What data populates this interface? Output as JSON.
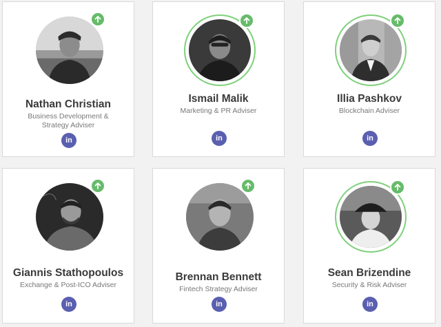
{
  "advisers": [
    {
      "name": "Nathan Christian",
      "role": "Business Development & Strategy Adviser",
      "linkedin_label": "in",
      "badge_icon": "arrow-up-icon"
    },
    {
      "name": "Ismail Malik",
      "role": "Marketing & PR Adviser",
      "linkedin_label": "in",
      "badge_icon": "arrow-up-icon"
    },
    {
      "name": "Illia Pashkov",
      "role": "Blockchain Adviser",
      "linkedin_label": "in",
      "badge_icon": "arrow-up-icon"
    },
    {
      "name": "Giannis Stathopoulos",
      "role": "Exchange & Post-ICO Adviser",
      "linkedin_label": "in",
      "badge_icon": "arrow-up-icon"
    },
    {
      "name": "Brennan Bennett",
      "role": "Fintech Strategy Adviser",
      "linkedin_label": "in",
      "badge_icon": "arrow-up-icon"
    },
    {
      "name": "Sean Brizendine",
      "role": "Security & Risk Adviser",
      "linkedin_label": "in",
      "badge_icon": "arrow-up-icon"
    }
  ],
  "colors": {
    "accent_green": "#66bb6a",
    "ring_green": "#7ed07a",
    "linkedin_purple": "#5a5fb0",
    "name_text": "#3a3a3a",
    "role_text": "#777777"
  }
}
